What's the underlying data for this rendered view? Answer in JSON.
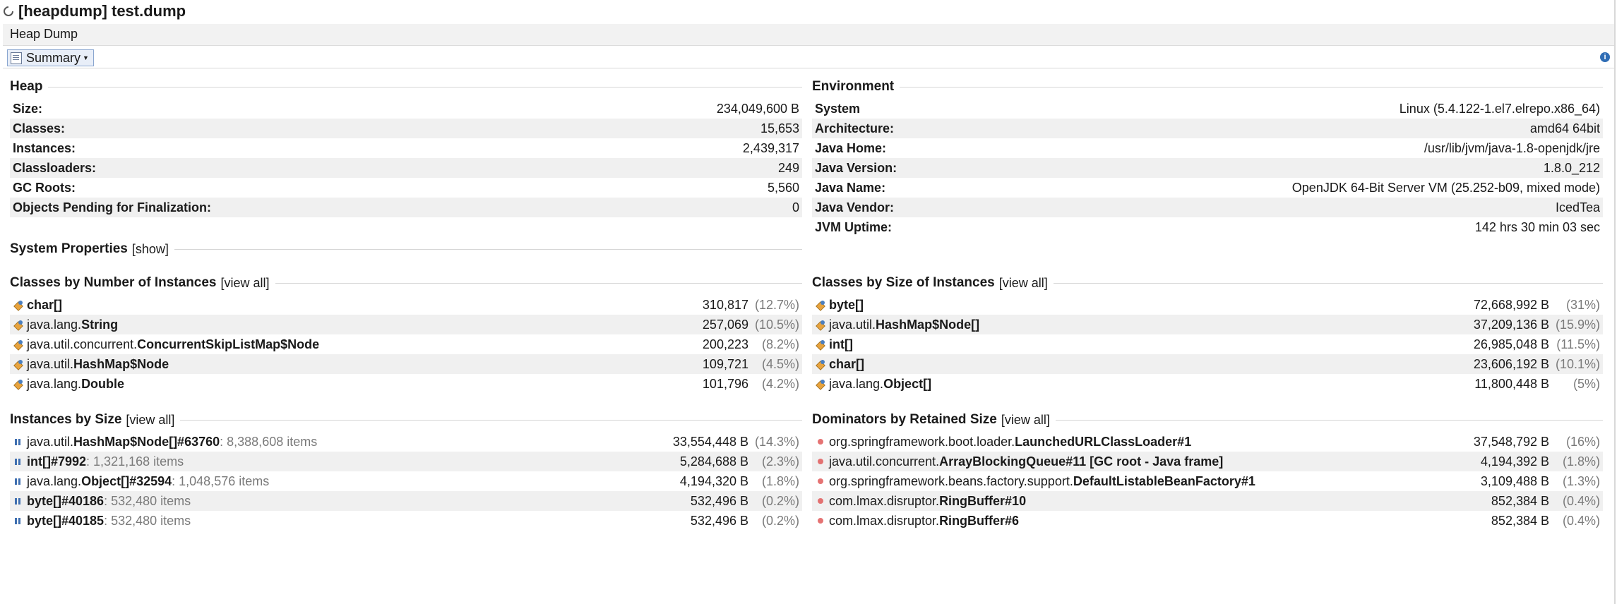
{
  "window": {
    "title": "[heapdump] test.dump"
  },
  "tab": {
    "label": "Heap Dump"
  },
  "toolbar": {
    "summary_label": "Summary"
  },
  "heap": {
    "title": "Heap",
    "rows": [
      {
        "label": "Size:",
        "value": "234,049,600 B"
      },
      {
        "label": "Classes:",
        "value": "15,653"
      },
      {
        "label": "Instances:",
        "value": "2,439,317"
      },
      {
        "label": "Classloaders:",
        "value": "249"
      },
      {
        "label": "GC Roots:",
        "value": "5,560"
      },
      {
        "label": "Objects Pending for Finalization:",
        "value": "0"
      }
    ]
  },
  "environment": {
    "title": "Environment",
    "rows": [
      {
        "label": "System",
        "value": "Linux (5.4.122-1.el7.elrepo.x86_64)"
      },
      {
        "label": "Architecture:",
        "value": "amd64 64bit"
      },
      {
        "label": "Java Home:",
        "value": "/usr/lib/jvm/java-1.8-openjdk/jre"
      },
      {
        "label": "Java Version:",
        "value": "1.8.0_212"
      },
      {
        "label": "Java Name:",
        "value": "OpenJDK 64-Bit Server VM (25.252-b09, mixed mode)"
      },
      {
        "label": "Java Vendor:",
        "value": "IcedTea"
      },
      {
        "label": "JVM Uptime:",
        "value": "142 hrs 30 min 03 sec"
      }
    ]
  },
  "system_properties": {
    "title": "System Properties",
    "link": "[show]"
  },
  "classes_by_count": {
    "title": "Classes by Number of Instances",
    "link": "[view all]",
    "rows": [
      {
        "pkg": "",
        "cls": "char[]",
        "value": "310,817",
        "pct": "(12.7%)"
      },
      {
        "pkg": "java.lang.",
        "cls": "String",
        "value": "257,069",
        "pct": "(10.5%)"
      },
      {
        "pkg": "java.util.concurrent.",
        "cls": "ConcurrentSkipListMap$Node",
        "value": "200,223",
        "pct": "(8.2%)"
      },
      {
        "pkg": "java.util.",
        "cls": "HashMap$Node",
        "value": "109,721",
        "pct": "(4.5%)"
      },
      {
        "pkg": "java.lang.",
        "cls": "Double",
        "value": "101,796",
        "pct": "(4.2%)"
      }
    ]
  },
  "classes_by_size": {
    "title": "Classes by Size of Instances",
    "link": "[view all]",
    "rows": [
      {
        "pkg": "",
        "cls": "byte[]",
        "value": "72,668,992 B",
        "pct": "(31%)"
      },
      {
        "pkg": "java.util.",
        "cls": "HashMap$Node[]",
        "value": "37,209,136 B",
        "pct": "(15.9%)"
      },
      {
        "pkg": "",
        "cls": "int[]",
        "value": "26,985,048 B",
        "pct": "(11.5%)"
      },
      {
        "pkg": "",
        "cls": "char[]",
        "value": "23,606,192 B",
        "pct": "(10.1%)"
      },
      {
        "pkg": "java.lang.",
        "cls": "Object[]",
        "value": "11,800,448 B",
        "pct": "(5%)"
      }
    ]
  },
  "instances_by_size": {
    "title": "Instances by Size",
    "link": "[view all]",
    "rows": [
      {
        "pkg": "java.util.",
        "cls": "HashMap$Node[]#63760",
        "items": ": 8,388,608 items",
        "value": "33,554,448 B",
        "pct": "(14.3%)"
      },
      {
        "pkg": "",
        "cls": "int[]#7992",
        "items": ": 1,321,168 items",
        "value": "5,284,688 B",
        "pct": "(2.3%)"
      },
      {
        "pkg": "java.lang.",
        "cls": "Object[]#32594",
        "items": ": 1,048,576 items",
        "value": "4,194,320 B",
        "pct": "(1.8%)"
      },
      {
        "pkg": "",
        "cls": "byte[]#40186",
        "items": ": 532,480 items",
        "value": "532,496 B",
        "pct": "(0.2%)"
      },
      {
        "pkg": "",
        "cls": "byte[]#40185",
        "items": ": 532,480 items",
        "value": "532,496 B",
        "pct": "(0.2%)"
      }
    ]
  },
  "dominators": {
    "title": "Dominators by Retained Size",
    "link": "[view all]",
    "rows": [
      {
        "pkg": "org.springframework.boot.loader.",
        "cls": "LaunchedURLClassLoader#1",
        "value": "37,548,792 B",
        "pct": "(16%)"
      },
      {
        "pkg": "java.util.concurrent.",
        "cls": "ArrayBlockingQueue#11 [GC root - Java frame]",
        "value": "4,194,392 B",
        "pct": "(1.8%)"
      },
      {
        "pkg": "org.springframework.beans.factory.support.",
        "cls": "DefaultListableBeanFactory#1",
        "value": "3,109,488 B",
        "pct": "(1.3%)"
      },
      {
        "pkg": "com.lmax.disruptor.",
        "cls": "RingBuffer#10",
        "value": "852,384 B",
        "pct": "(0.4%)"
      },
      {
        "pkg": "com.lmax.disruptor.",
        "cls": "RingBuffer#6",
        "value": "852,384 B",
        "pct": "(0.4%)"
      }
    ]
  }
}
